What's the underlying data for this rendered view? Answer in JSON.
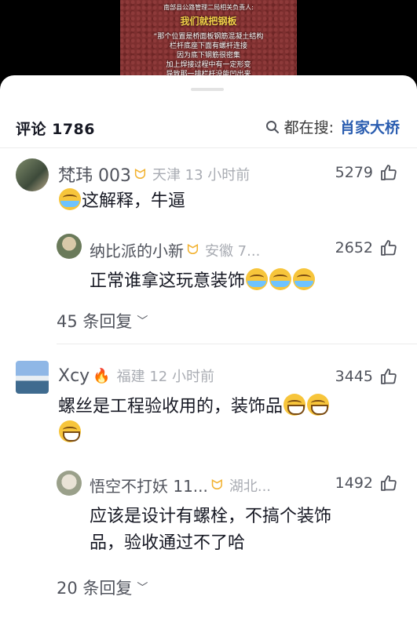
{
  "video": {
    "line0": "南部县公路管理二局相关负责人:",
    "title": "我们就把钢板",
    "lines": [
      "“那个位置是桥面板钢筋混凝土结构",
      "栏杆底座下面有螺杆连接",
      "因为底下钢筋很密集",
      "加上焊接过程中有一定形变",
      "导致那一排栏杆没能凹出来"
    ]
  },
  "header": {
    "title": "评论 1786",
    "search_label": "都在搜:",
    "search_keyword": "肖家大桥"
  },
  "comments": [
    {
      "user": "梵玮 003",
      "location": "天津 13 小时前",
      "likes": "5279",
      "text": "这解释，牛逼",
      "reply": {
        "user": "纳比派的小新",
        "location": "安徽 7...",
        "likes": "2652",
        "text": "正常谁拿这玩意装饰"
      },
      "more_replies": "45 条回复"
    },
    {
      "user": "Xcy",
      "location": "福建 12 小时前",
      "likes": "3445",
      "text": "螺丝是工程验收用的，装饰品",
      "reply": {
        "user": "悟空不打妖 11...",
        "location": "湖北...",
        "likes": "1492",
        "text_line1": "应该是设计有螺栓，不搞个装饰",
        "text_line2": "品，验收通过不了哈"
      },
      "more_replies": "20 条回复"
    }
  ],
  "icons": {
    "badge": "creator-badge-icon",
    "like": "thumbs-up-icon",
    "search": "search-icon",
    "chevron": "chevron-down-icon",
    "emoji_cry": "laugh-cry-emoji-icon",
    "emoji_grin": "grin-emoji-icon",
    "fire": "fire-icon"
  },
  "colors": {
    "accent_link": "#2a5db0",
    "badge": "#f2b230"
  }
}
